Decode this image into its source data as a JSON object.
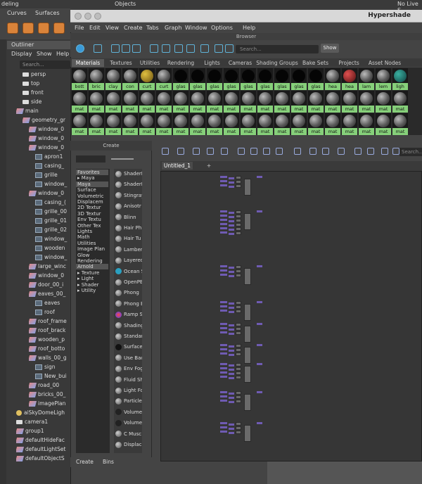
{
  "top": {
    "mode": "deling",
    "objects": "Objects",
    "no_live": "No Live S"
  },
  "maya_menu": [
    "Curves",
    "Surfaces"
  ],
  "outliner": {
    "title": "Outliner",
    "menu": [
      "Display",
      "Show",
      "Help"
    ],
    "search_placeholder": "Search...",
    "items": [
      {
        "label": "persp",
        "depth": 2,
        "icon": "camera-icon"
      },
      {
        "label": "top",
        "depth": 2,
        "icon": "camera-icon"
      },
      {
        "label": "front",
        "depth": 2,
        "icon": "camera-icon"
      },
      {
        "label": "side",
        "depth": 2,
        "icon": "camera-icon"
      },
      {
        "label": "main",
        "depth": 1,
        "icon": "group-icon"
      },
      {
        "label": "geometry_gr",
        "depth": 2,
        "icon": "group-icon"
      },
      {
        "label": "window_0",
        "depth": 3,
        "icon": "group-icon"
      },
      {
        "label": "window_0",
        "depth": 3,
        "icon": "group-icon"
      },
      {
        "label": "window_0",
        "depth": 3,
        "icon": "group-icon"
      },
      {
        "label": "apron1",
        "depth": 4,
        "icon": "mesh-icon"
      },
      {
        "label": "casing_",
        "depth": 4,
        "icon": "mesh-icon"
      },
      {
        "label": "grille",
        "depth": 4,
        "icon": "mesh-icon"
      },
      {
        "label": "window_",
        "depth": 4,
        "icon": "mesh-icon"
      },
      {
        "label": "window_0",
        "depth": 3,
        "icon": "group-icon"
      },
      {
        "label": "casing_(",
        "depth": 4,
        "icon": "mesh-icon"
      },
      {
        "label": "grille_00",
        "depth": 4,
        "icon": "mesh-icon"
      },
      {
        "label": "grille_01",
        "depth": 4,
        "icon": "mesh-icon"
      },
      {
        "label": "grille_02",
        "depth": 4,
        "icon": "mesh-icon"
      },
      {
        "label": "window_",
        "depth": 4,
        "icon": "mesh-icon"
      },
      {
        "label": "wooden",
        "depth": 4,
        "icon": "mesh-icon"
      },
      {
        "label": "window_",
        "depth": 4,
        "icon": "mesh-icon"
      },
      {
        "label": "large_winc",
        "depth": 3,
        "icon": "group-icon"
      },
      {
        "label": "window_0",
        "depth": 3,
        "icon": "group-icon"
      },
      {
        "label": "door_00_i",
        "depth": 3,
        "icon": "group-icon"
      },
      {
        "label": "eaves_00_",
        "depth": 3,
        "icon": "group-icon"
      },
      {
        "label": "eaves",
        "depth": 4,
        "icon": "mesh-icon"
      },
      {
        "label": "roof",
        "depth": 4,
        "icon": "mesh-icon"
      },
      {
        "label": "roof_frame",
        "depth": 3,
        "icon": "group-icon"
      },
      {
        "label": "roof_brack",
        "depth": 3,
        "icon": "group-icon"
      },
      {
        "label": "wooden_p",
        "depth": 3,
        "icon": "group-icon"
      },
      {
        "label": "roof_botto",
        "depth": 3,
        "icon": "group-icon"
      },
      {
        "label": "walls_00_g",
        "depth": 3,
        "icon": "group-icon"
      },
      {
        "label": "sign",
        "depth": 4,
        "icon": "mesh-icon"
      },
      {
        "label": "New_bui",
        "depth": 4,
        "icon": "mesh-icon"
      },
      {
        "label": "road_00",
        "depth": 3,
        "icon": "group-icon"
      },
      {
        "label": "bricks_00_",
        "depth": 3,
        "icon": "group-icon"
      },
      {
        "label": "imagePlan",
        "depth": 3,
        "icon": "group-icon"
      },
      {
        "label": "aiSkyDomeLigh",
        "depth": 1,
        "icon": "light-icon"
      },
      {
        "label": "camera1",
        "depth": 1,
        "icon": "camera-icon"
      },
      {
        "label": "group1",
        "depth": 1,
        "icon": "group-icon"
      },
      {
        "label": "defaultHideFac",
        "depth": 1,
        "icon": "group-icon"
      },
      {
        "label": "defaultLightSet",
        "depth": 1,
        "icon": "group-icon"
      },
      {
        "label": "defaultObjectS",
        "depth": 1,
        "icon": "group-icon"
      }
    ]
  },
  "hypershade": {
    "title": "Hypershade",
    "menu": [
      "File",
      "Edit",
      "View",
      "Create",
      "Tabs",
      "Graph",
      "Window",
      "Options",
      "Help"
    ],
    "browser_label": "Browser",
    "search_placeholder": "Search...",
    "show_label": "Show",
    "tabs": [
      "Materials",
      "Textures",
      "Utilities",
      "Rendering",
      "Lights",
      "Cameras",
      "Shading Groups",
      "Bake Sets",
      "Projects",
      "Asset Nodes"
    ],
    "swatch_row1": [
      "bott",
      "bric",
      "clay",
      "con",
      "curt",
      "curt",
      "glas",
      "glas",
      "glas",
      "glas",
      "glas",
      "glas",
      "glas",
      "glas",
      "glas",
      "hea",
      "hea",
      "lam",
      "lem",
      "ligh"
    ],
    "swatch_row2": [
      "mat",
      "mat",
      "mat",
      "mat",
      "mat",
      "mat",
      "mat",
      "mat",
      "mat",
      "mat",
      "mat",
      "mat",
      "mat",
      "mat",
      "mat",
      "mat",
      "mat",
      "mat",
      "mat",
      "mat"
    ],
    "swatch_row3": [
      "mat",
      "mat",
      "mat",
      "mat",
      "mat",
      "mat",
      "mat",
      "mat",
      "mat",
      "mat",
      "mat",
      "mat",
      "mat",
      "mat",
      "mat",
      "mat",
      "mat",
      "mat",
      "mat",
      "mat"
    ]
  },
  "create_panel": {
    "title": "Create",
    "categories": [
      {
        "label": "Favorites",
        "header": true
      },
      {
        "label": "▸ Maya",
        "header": false
      },
      {
        "label": "Maya",
        "header": true
      },
      {
        "label": "Surface",
        "header": false
      },
      {
        "label": "Volumetric",
        "header": false
      },
      {
        "label": "Displacem",
        "header": false
      },
      {
        "label": "2D Textur",
        "header": false
      },
      {
        "label": "3D Textur",
        "header": false
      },
      {
        "label": "Env Textu",
        "header": false
      },
      {
        "label": "Other Tex",
        "header": false
      },
      {
        "label": "Lights",
        "header": false
      },
      {
        "label": "Math",
        "header": false
      },
      {
        "label": "Utilities",
        "header": false
      },
      {
        "label": "Image Plan",
        "header": false
      },
      {
        "label": "Glow",
        "header": false
      },
      {
        "label": "Rendering",
        "header": false
      },
      {
        "label": "Arnold",
        "header": true
      },
      {
        "label": "▸ Texture",
        "header": false
      },
      {
        "label": "▸ Light",
        "header": false
      },
      {
        "label": "▸ Shader",
        "header": false
      },
      {
        "label": "▸ Utility",
        "header": false
      }
    ],
    "nodes": [
      "ShaderF",
      "ShaderF",
      "Stingray",
      "Anisotr",
      "Blinn",
      "Hair Ph",
      "Hair Tu",
      "Lamber",
      "Layered",
      "Ocean S",
      "OpenPB",
      "Phong",
      "Phong E",
      "Ramp S",
      "Shading",
      "Standar",
      "Surface",
      "Use Bac",
      "Env Fog",
      "Fluid Sh",
      "Light Fo",
      "Particle",
      "Volume",
      "Volume",
      "C Musc",
      "Displac"
    ],
    "bottom_tabs": [
      "Create",
      "Bins"
    ]
  },
  "graph": {
    "tab_label": "Untitled_1",
    "add_tab": "+",
    "search_placeholder": "Search..."
  }
}
